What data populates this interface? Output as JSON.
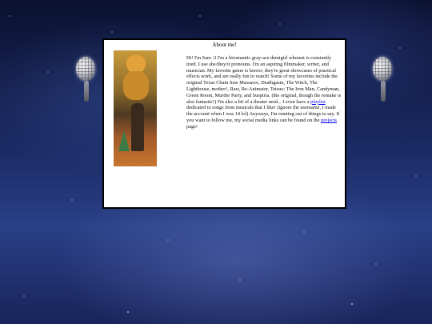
{
  "window": {
    "title": "About me!"
  },
  "bio": {
    "text_before_playlist": "Hi! I'm Sam :3 I'm a biromantic gray-ace demigirl whomst is constantly tired. I use she/they/it pronouns. I'm an aspiring filmmaker, writer, and musician. My favorite genre is horror; they're great showcases of practical effects work, and are really fun to watch! Some of my favorites include the original Texas Chain Saw Massacre, Deathgasm, The Witch, The Lighthouse, mother!, Raw, Re-Animator, Tetsuo: The Iron Man, Candyman, Green Room, Murder Party, and Suspiria. (the original, though the remake is also fantastic!) I'm also a bit of a theater nerd... I even have a ",
    "playlist_link": "playlist",
    "text_between_links": " dedicated to songs from musicals that I like! (ignore the username, I made the account when I was 14 lol) Anyways, I'm running out of things to say. If you want to follow me, my social media links can be found on the ",
    "projects_link": "projects",
    "text_after_projects": " page!"
  },
  "colors": {
    "window_bg": "#ffffff",
    "window_border": "#000000",
    "link": "#0000ee"
  },
  "icons": {
    "left_decoration": "disco-ball-icon",
    "right_decoration": "disco-ball-icon"
  }
}
